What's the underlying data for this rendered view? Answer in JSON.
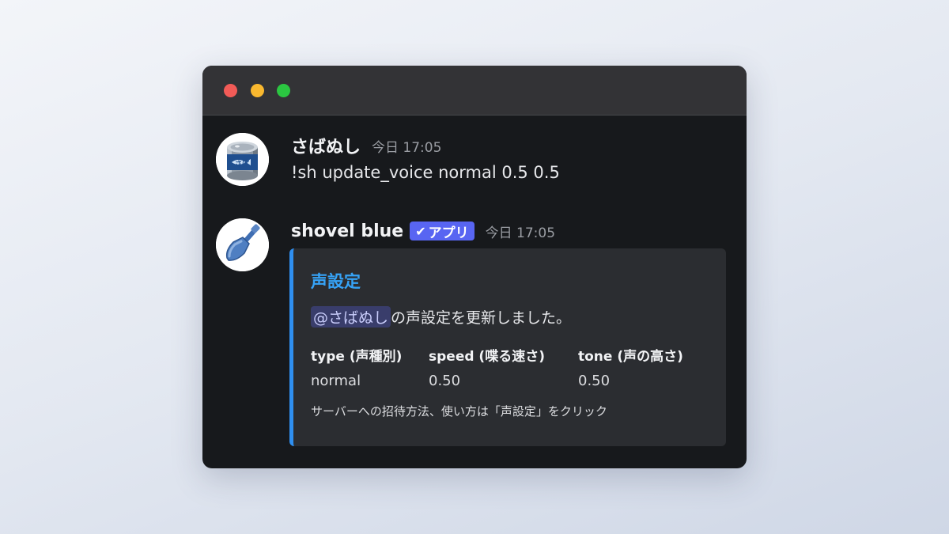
{
  "window": {
    "controls": [
      "close",
      "minimize",
      "maximize"
    ]
  },
  "messages": [
    {
      "username": "さばぬし",
      "timestamp": "今日 17:05",
      "content": "!sh update_voice normal 0.5 0.5",
      "avatar_icon": "canned-mackerel-icon",
      "avatar_label": "さば"
    },
    {
      "username": "shovel blue",
      "badge": "アプリ",
      "badge_icon": "checkmark-icon",
      "timestamp": "今日 17:05",
      "avatar_icon": "shovel-icon",
      "embed": {
        "title": "声設定",
        "mention": "@さばぬし",
        "description_suffix": "の声設定を更新しました。",
        "fields": [
          {
            "name": "type (声種別)",
            "value": "normal"
          },
          {
            "name": "speed (喋る速さ)",
            "value": "0.50"
          },
          {
            "name": "tone (声の高さ)",
            "value": "0.50"
          }
        ],
        "footer": "サーバーへの招待方法、使い方は「声設定」をクリック",
        "accent_color": "#2f8ff0"
      }
    }
  ],
  "colors": {
    "window_bg": "#17191c",
    "titlebar_bg": "#333336",
    "badge_bg": "#5865f2",
    "embed_title": "#36a3f7"
  }
}
